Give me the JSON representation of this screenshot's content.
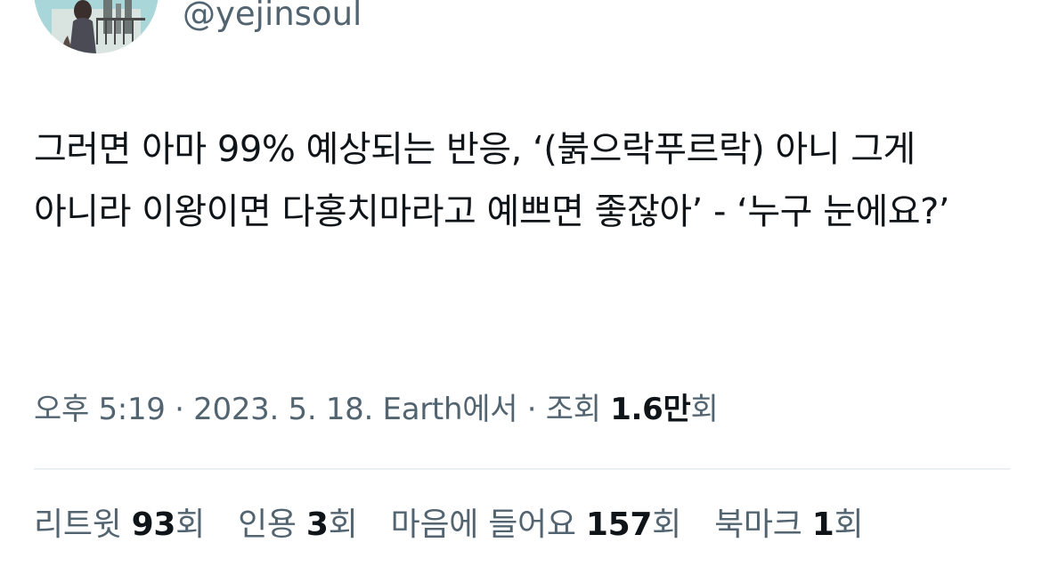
{
  "header": {
    "handle": "@yejinsoul"
  },
  "tweet": {
    "text": "그러면 아마 99% 예상되는 반응, ‘(붉으락푸르락) 아니 그게 아니라 이왕이면 다홍치마라고 예쁘면 좋잖아’ - ‘누구 눈에요?’"
  },
  "meta": {
    "time": "오후 5:19",
    "sep1": " · ",
    "date": "2023. 5. 18.",
    "source": " Earth에서",
    "sep2": " · ",
    "views_label": "조회 ",
    "views_count": "1.6만",
    "views_suffix": "회"
  },
  "stats": {
    "retweets": {
      "label": "리트윗 ",
      "count": "93",
      "suffix": "회"
    },
    "quotes": {
      "label": "인용 ",
      "count": "3",
      "suffix": "회"
    },
    "likes": {
      "label": "마음에 들어요 ",
      "count": "157",
      "suffix": "회"
    },
    "bookmarks": {
      "label": "북마크 ",
      "count": "1",
      "suffix": "회"
    }
  },
  "colors": {
    "text_primary": "#0f1419",
    "text_secondary": "#536471",
    "divider": "#eff3f4",
    "avatar_bg": "#a9d7d9"
  }
}
